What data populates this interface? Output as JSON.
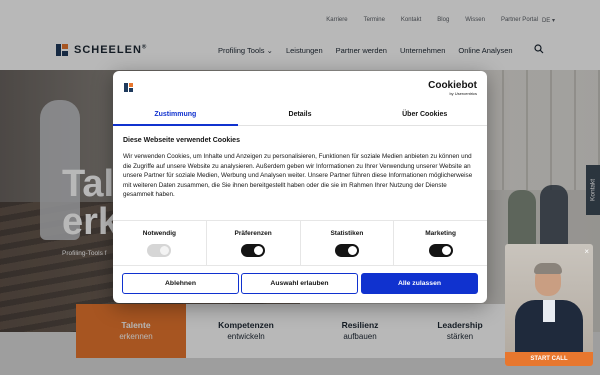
{
  "top_nav": [
    "Karriere",
    "Termine",
    "Kontakt",
    "Blog",
    "Wissen",
    "Partner Portal"
  ],
  "lang": "DE",
  "brand": "SCHEELEN",
  "brand_reg": "®",
  "main_nav": {
    "profiling": "Profiling Tools",
    "leistungen": "Leistungen",
    "partner": "Partner werden",
    "unternehmen": "Unternehmen",
    "analysen": "Online Analysen"
  },
  "hero": {
    "title_line1": "Tal",
    "title_line2": "erk",
    "subtitle": "Profiling-Tools f"
  },
  "kontakt_tab": "Kontakt",
  "tabs": [
    {
      "line1": "Talente",
      "line2": "erkennen"
    },
    {
      "line1": "Kompetenzen",
      "line2": "entwickeln"
    },
    {
      "line1": "Resilienz",
      "line2": "aufbauen"
    },
    {
      "line1": "Leadership",
      "line2": "stärken"
    }
  ],
  "cookie": {
    "provider": "Cookiebot",
    "provider_by": "by Usercentrics",
    "tabs": [
      "Zustimmung",
      "Details",
      "Über Cookies"
    ],
    "heading": "Diese Webseite verwendet Cookies",
    "body": "Wir verwenden Cookies, um Inhalte und Anzeigen zu personalisieren, Funktionen für soziale Medien anbieten zu können und die Zugriffe auf unsere Website zu analysieren. Außerdem geben wir Informationen zu Ihrer Verwendung unserer Website an unsere Partner für soziale Medien, Werbung und Analysen weiter. Unsere Partner führen diese Informationen möglicherweise mit weiteren Daten zusammen, die Sie ihnen bereitgestellt haben oder die sie im Rahmen Ihrer Nutzung der Dienste gesammelt haben.",
    "toggles": [
      {
        "label": "Notwendig",
        "state": "on-disabled"
      },
      {
        "label": "Präferenzen",
        "state": "on"
      },
      {
        "label": "Statistiken",
        "state": "on"
      },
      {
        "label": "Marketing",
        "state": "on"
      }
    ],
    "btn_reject": "Ablehnen",
    "btn_selection": "Auswahl erlauben",
    "btn_all": "Alle zulassen"
  },
  "video": {
    "close": "×",
    "cta": "START CALL"
  },
  "colors": {
    "accent": "#e8772e",
    "navy": "#1f3a5c",
    "cookie_blue": "#1032cf"
  }
}
